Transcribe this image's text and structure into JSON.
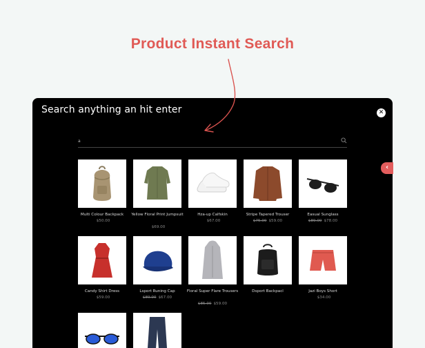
{
  "headline": "Product Instant Search",
  "modal": {
    "title": "Search anything an hit enter",
    "close_icon": "close-icon",
    "search": {
      "value": "a",
      "placeholder": "",
      "icon": "search-icon"
    }
  },
  "side_tab": {
    "icon": "chevron-left-icon",
    "color": "#e35d5d"
  },
  "products": [
    {
      "name": "Multi Colour Backpack",
      "old_price": "",
      "price": "$50.00",
      "icon": "backpack-icon"
    },
    {
      "name": "Yellow Floral Print Jumpsuit",
      "old_price": "",
      "price": "$69.00",
      "icon": "shirt-dress-icon"
    },
    {
      "name": "Hza-up Calfskin",
      "old_price": "",
      "price": "$67.00",
      "icon": "sneakers-icon"
    },
    {
      "name": "Stripe Tapered Trouser",
      "old_price": "$75.00",
      "price": "$59.00",
      "icon": "jacket-icon"
    },
    {
      "name": "Easual Sunglass",
      "old_price": "$89.00",
      "price": "$78.00",
      "icon": "sunglasses-icon"
    },
    {
      "name": "Candy Shirt Dress",
      "old_price": "",
      "price": "$59.00",
      "icon": "red-dress-icon"
    },
    {
      "name": "Lsport Runing Cap",
      "old_price": "$89.00",
      "price": "$67.00",
      "icon": "cap-icon"
    },
    {
      "name": "Floral Super Flare Trousers",
      "old_price": "$85.00",
      "price": "$59.00",
      "icon": "coat-icon"
    },
    {
      "name": "Dsport Backpacl",
      "old_price": "",
      "price": "",
      "icon": "black-backpack-icon"
    },
    {
      "name": "Jazi Boys Short",
      "old_price": "",
      "price": "$34.00",
      "icon": "shorts-icon"
    },
    {
      "name": "",
      "old_price": "",
      "price": "",
      "icon": "blue-sunglasses-icon"
    },
    {
      "name": "",
      "old_price": "",
      "price": "",
      "icon": "trousers-icon"
    }
  ],
  "colors": {
    "accent": "#e05a55",
    "modal_bg": "#000000",
    "page_bg": "#f3f7f6"
  }
}
